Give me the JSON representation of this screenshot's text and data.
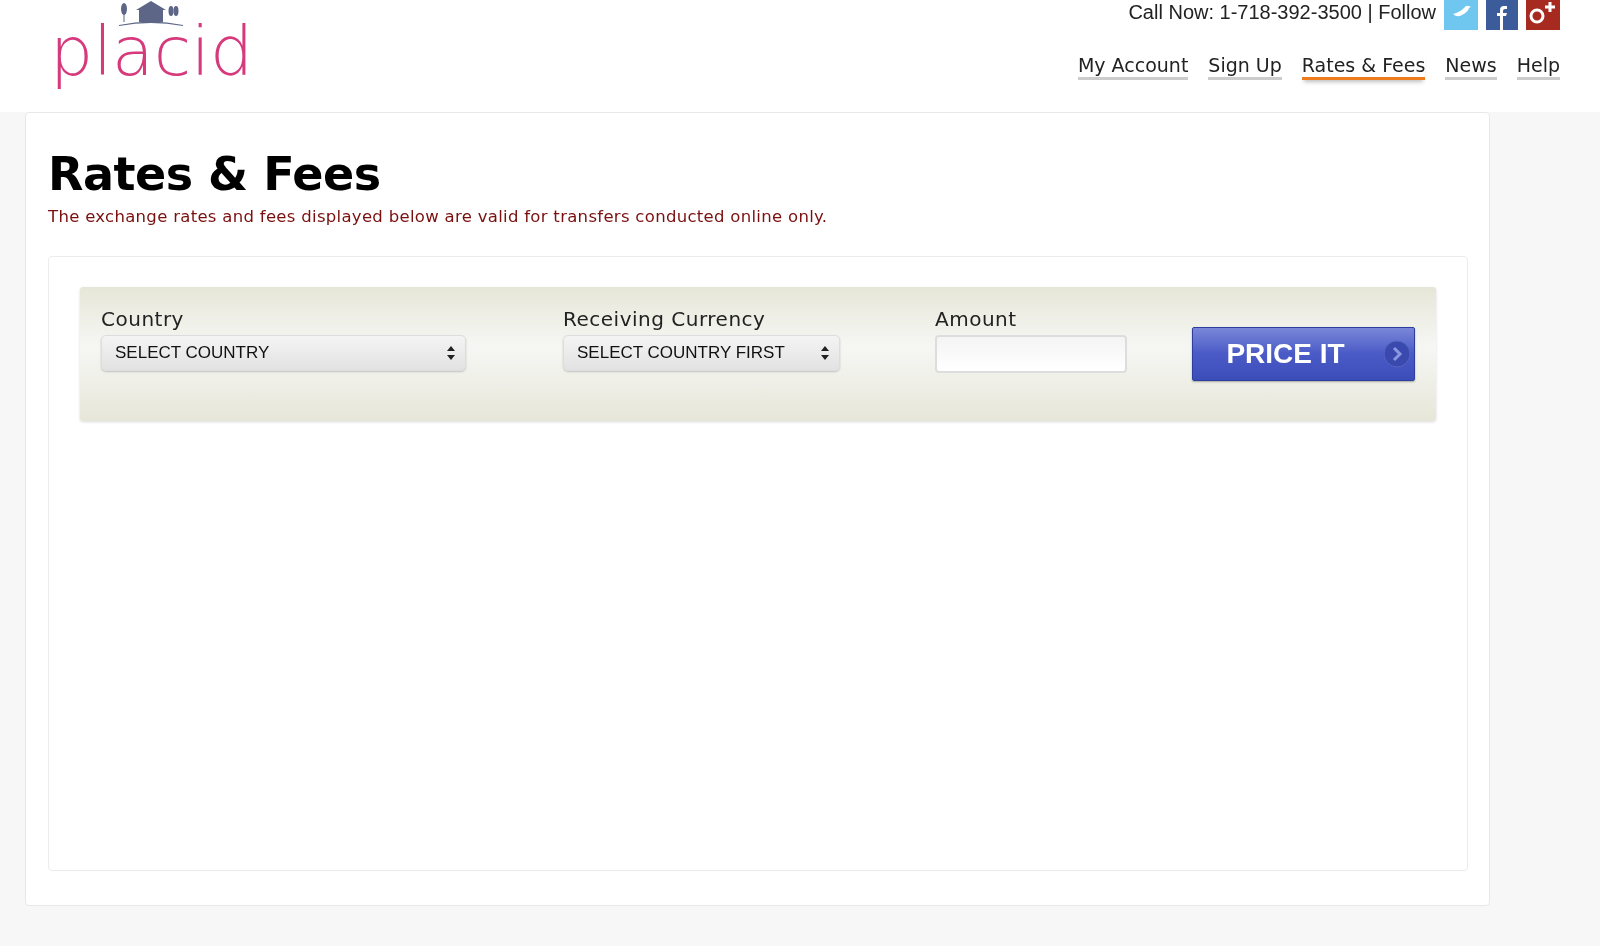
{
  "header": {
    "logo": "placid",
    "contact": "Call Now: 1-718-392-3500 | Follow"
  },
  "nav": [
    {
      "label": "My Account",
      "selected": false
    },
    {
      "label": "Sign Up",
      "selected": false
    },
    {
      "label": "Rates & Fees",
      "selected": true
    },
    {
      "label": "News",
      "selected": false
    },
    {
      "label": "Help",
      "selected": false
    }
  ],
  "page": {
    "title": "Rates & Fees",
    "note": "The exchange rates and fees displayed below are valid for transfers conducted online only."
  },
  "form": {
    "fields": [
      {
        "kind": "select",
        "label": "Country",
        "value": "SELECT COUNTRY"
      },
      {
        "kind": "select",
        "label": "Receiving Currency",
        "value": "SELECT COUNTRY FIRST"
      },
      {
        "kind": "input",
        "label": "Amount"
      }
    ],
    "button": "PRICE IT"
  }
}
